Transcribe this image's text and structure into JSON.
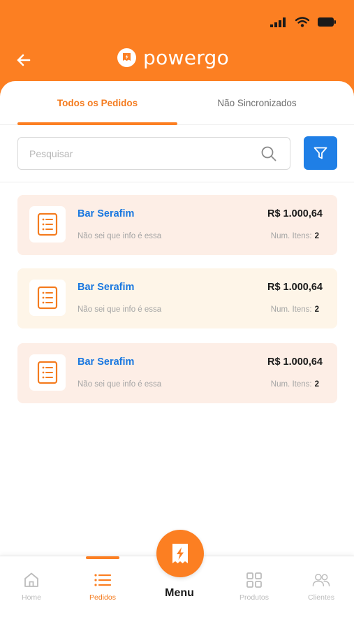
{
  "header": {
    "app_name": "powergo",
    "brand_color": "#fc7f22",
    "status_icons": [
      "signal-icon",
      "wifi-icon",
      "battery-icon"
    ],
    "back_icon": "arrow-left-icon"
  },
  "tabs": [
    {
      "label": "Todos os Pedidos",
      "active": true
    },
    {
      "label": "Não Sincronizados",
      "active": false
    }
  ],
  "search": {
    "placeholder": "Pesquisar",
    "value": "",
    "icon": "search-icon",
    "filter_icon": "filter-icon",
    "filter_color": "#1f7fe6"
  },
  "orders": [
    {
      "title": "Bar Serafim",
      "subtitle": "Não sei que info é essa",
      "price": "R$ 1.000,64",
      "items_label": "Num. Itens:",
      "items_count": "2",
      "background": "#fdeee6"
    },
    {
      "title": "Bar Serafim",
      "subtitle": "Não sei que info é essa",
      "price": "R$ 1.000,64",
      "items_label": "Num. Itens:",
      "items_count": "2",
      "background": "#fef5e8"
    },
    {
      "title": "Bar Serafim",
      "subtitle": "Não sei que info é essa",
      "price": "R$ 1.000,64",
      "items_label": "Num. Itens:",
      "items_count": "2",
      "background": "#fdeee6"
    }
  ],
  "bottom_nav": {
    "items": [
      {
        "label": "Home",
        "icon": "home-icon",
        "active": false
      },
      {
        "label": "Pedidos",
        "icon": "list-icon",
        "active": true
      },
      {
        "label": "Produtos",
        "icon": "grid-icon",
        "active": false
      },
      {
        "label": "Clientes",
        "icon": "users-icon",
        "active": false
      }
    ],
    "menu_label": "Menu",
    "menu_icon": "receipt-bolt-icon"
  }
}
